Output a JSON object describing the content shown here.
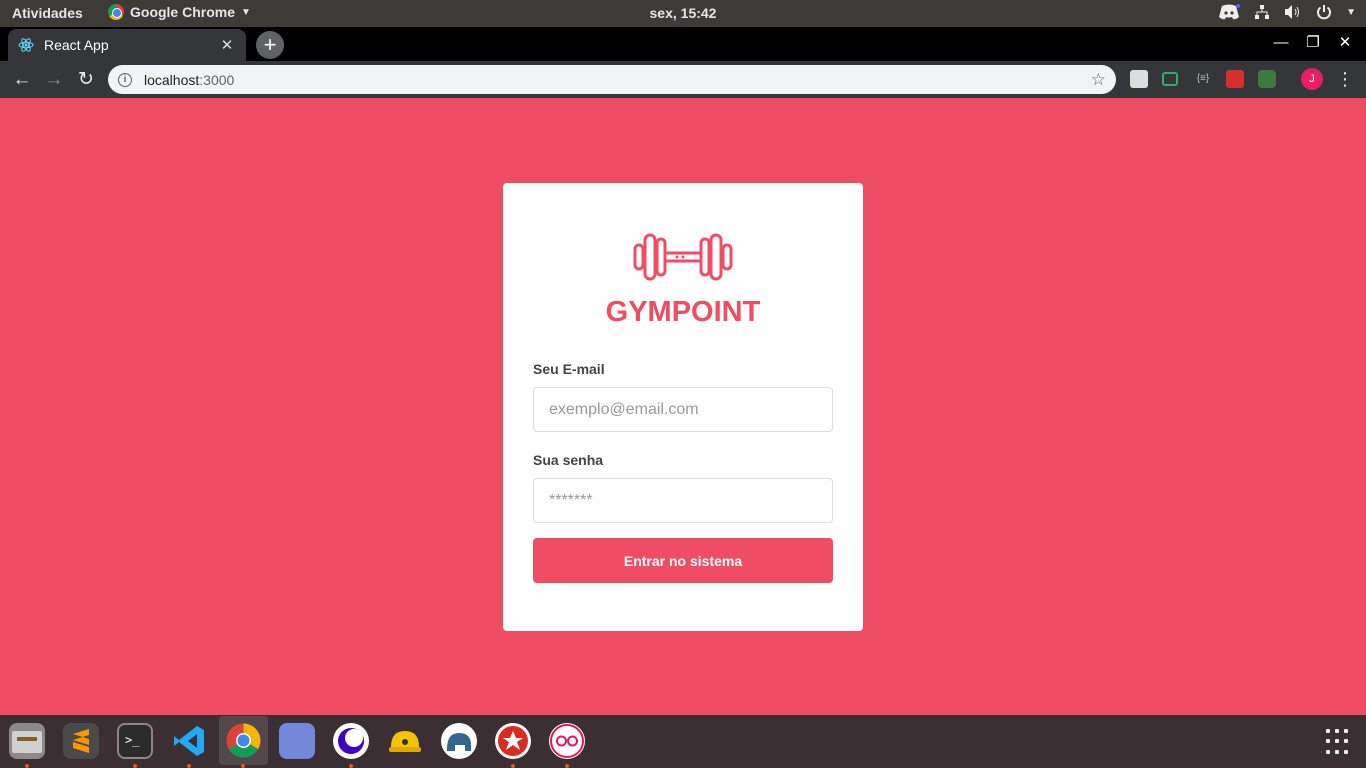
{
  "topbar": {
    "activities": "Atividades",
    "app_name": "Google Chrome",
    "clock": "sex, 15:42"
  },
  "browser": {
    "tab_title": "React App",
    "url_host": "localhost",
    "url_port": ":3000",
    "avatar_letter": "J"
  },
  "login": {
    "brand": "GYMPOINT",
    "email_label": "Seu E-mail",
    "email_placeholder": "exemplo@email.com",
    "password_label": "Sua senha",
    "password_placeholder": "*******",
    "submit_label": "Entrar no sistema"
  },
  "colors": {
    "brand": "#ee4d64",
    "background": "#ee4d64"
  },
  "dock": {
    "apps": [
      "files-icon",
      "sublime-text-icon",
      "terminal-icon",
      "vscode-icon",
      "chrome-icon",
      "discord-icon",
      "insomnia-icon",
      "robo3t-icon",
      "postbird-icon",
      "redis-icon",
      "beekeeper-icon"
    ]
  }
}
